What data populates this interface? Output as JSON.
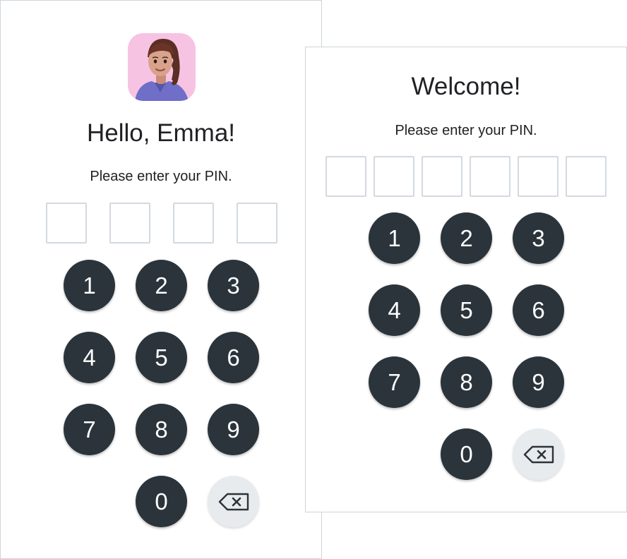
{
  "left_screen": {
    "greeting": "Hello, Emma!",
    "prompt": "Please enter your PIN.",
    "pin_length": 4,
    "avatar_icon": "user-avatar",
    "keys": [
      "1",
      "2",
      "3",
      "4",
      "5",
      "6",
      "7",
      "8",
      "9",
      "0"
    ],
    "backspace_icon": "backspace-icon"
  },
  "right_screen": {
    "greeting": "Welcome!",
    "prompt": "Please enter your PIN.",
    "pin_length": 6,
    "keys": [
      "1",
      "2",
      "3",
      "4",
      "5",
      "6",
      "7",
      "8",
      "9",
      "0"
    ],
    "backspace_icon": "backspace-icon"
  },
  "colors": {
    "key_bg": "#2b343a",
    "backspace_bg": "#e8ebee",
    "avatar_bg": "#f7c3e3",
    "pin_border": "#d3d9df"
  }
}
